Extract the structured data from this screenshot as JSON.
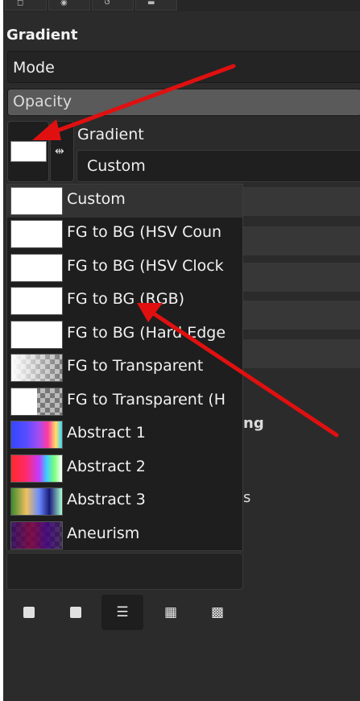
{
  "top_tabs": [
    {
      "icon": "brush-icon"
    },
    {
      "icon": "layers-icon"
    },
    {
      "icon": "paths-icon"
    },
    {
      "icon": "document-icon"
    }
  ],
  "section_title": "Gradient",
  "mode_label": "Mode",
  "opacity_label": "Opacity",
  "gradient_label": "Gradient",
  "gradient_value": "Custom",
  "reverse_icon": "reverse-gradient-icon",
  "obscured_text": "ng",
  "obscured_text2": "s",
  "gradient_list": [
    {
      "label": "Custom",
      "preview": "white",
      "selected": true
    },
    {
      "label": "FG to BG (HSV Coun",
      "preview": "white"
    },
    {
      "label": "FG to BG (HSV Clock",
      "preview": "white"
    },
    {
      "label": "FG to BG (RGB)",
      "preview": "white"
    },
    {
      "label": "FG to BG (Hard Edge",
      "preview": "white"
    },
    {
      "label": "FG to Transparent",
      "preview": "white-to-transparent"
    },
    {
      "label": "FG to Transparent (H",
      "preview": "white-hard-transparent"
    },
    {
      "label": "Abstract 1",
      "preview": "abstract-1"
    },
    {
      "label": "Abstract 2",
      "preview": "abstract-2"
    },
    {
      "label": "Abstract 3",
      "preview": "abstract-3"
    },
    {
      "label": "Aneurism",
      "preview": "aneurism"
    }
  ],
  "toolbar": [
    {
      "name": "minimize-icon",
      "glyph": "▬"
    },
    {
      "name": "add-icon",
      "glyph": "⊞"
    },
    {
      "name": "list-view-icon",
      "glyph": "☰",
      "active": true
    },
    {
      "name": "grid-view-icon",
      "glyph": "▦"
    },
    {
      "name": "checker-view-icon",
      "glyph": "▩"
    }
  ],
  "colors": {
    "panel_bg": "#2b2b2b",
    "popup_bg": "#1e1e1e",
    "annotation_arrow": "#e01010"
  }
}
